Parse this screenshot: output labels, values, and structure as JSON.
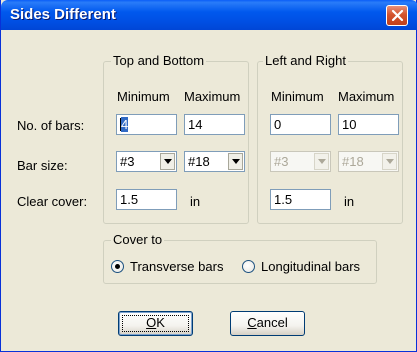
{
  "window": {
    "title": "Sides Different"
  },
  "top_bottom": {
    "legend": "Top and Bottom",
    "min_header": "Minimum",
    "max_header": "Maximum",
    "bars_min": "4",
    "bars_max": "14",
    "size_min": "#3",
    "size_max": "#18",
    "cover": "1.5",
    "cover_unit": "in"
  },
  "left_right": {
    "legend": "Left and Right",
    "min_header": "Minimum",
    "max_header": "Maximum",
    "bars_min": "0",
    "bars_max": "10",
    "size_min": "#3",
    "size_max": "#18",
    "cover": "1.5",
    "cover_unit": "in"
  },
  "rows": {
    "bars": "No. of bars:",
    "size": "Bar size:",
    "cover": "Clear cover:"
  },
  "cover_to": {
    "legend": "Cover to",
    "options": [
      "Transverse bars",
      "Longitudinal bars"
    ],
    "selected": "Transverse bars"
  },
  "buttons": {
    "ok_mnemonic": "O",
    "ok_rest": "K",
    "cancel_mnemonic": "C",
    "cancel_rest": "ancel"
  }
}
